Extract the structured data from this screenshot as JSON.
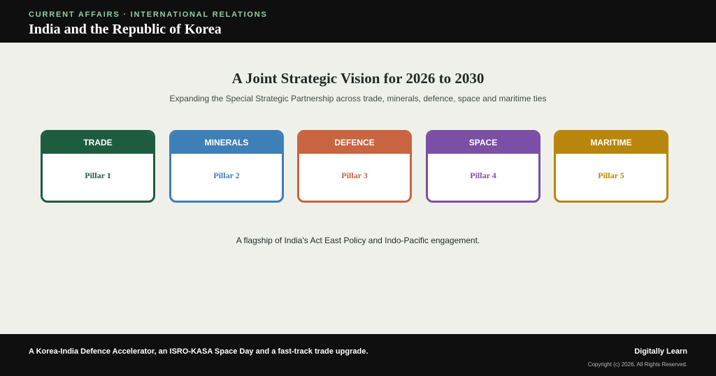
{
  "header": {
    "kicker": "CURRENT AFFAIRS · INTERNATIONAL RELATIONS",
    "title": "India and the Republic of Korea"
  },
  "main": {
    "headline": "A Joint Strategic Vision for 2026 to 2030",
    "subheadline": "Expanding the Special Strategic Partnership across trade, minerals, defence, space and maritime ties",
    "pillars": [
      {
        "name": "TRADE",
        "label": "Pillar 1",
        "color": "#1e5c40"
      },
      {
        "name": "MINERALS",
        "label": "Pillar 2",
        "color": "#3f7fb8"
      },
      {
        "name": "DEFENCE",
        "label": "Pillar 3",
        "color": "#c86440"
      },
      {
        "name": "SPACE",
        "label": "Pillar 4",
        "color": "#7b4fa5"
      },
      {
        "name": "MARITIME",
        "label": "Pillar 5",
        "color": "#b8860b"
      }
    ],
    "tagline": "A flagship of India's Act East Policy and Indo-Pacific engagement."
  },
  "footer": {
    "text": "A Korea-India Defence Accelerator, an ISRO-KASA Space Day and a fast-track trade upgrade.",
    "brand": "Digitally Learn",
    "copyright": "Copyright (c) 2026. All Rights Reserved."
  }
}
